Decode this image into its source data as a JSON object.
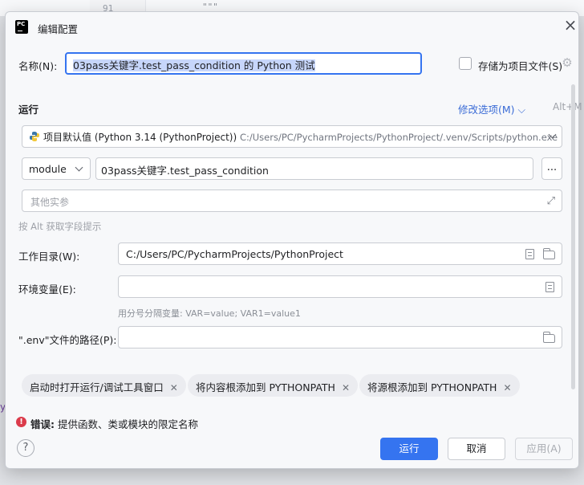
{
  "background": {
    "gutter_line": "91",
    "code_text": "\"\"\"",
    "left_glyph": "y"
  },
  "dialog": {
    "logo_text": "PC",
    "title": "编辑配置",
    "name_label": "名称(N):",
    "name_value": "03pass关键字.test_pass_condition 的 Python 测试",
    "store_as_file_label": "存储为项目文件(S)",
    "store_as_file_checked": false,
    "run_section": "运行",
    "modify_options": "修改选项(M)",
    "modify_shortcut": "Alt+M",
    "interpreter_label": "项目默认值 (Python 3.14 (PythonProject))",
    "interpreter_path": "C:/Users/PC/PycharmProjects/PythonProject/.venv/Scripts/python.exe",
    "target_type": "module",
    "target_value": "03pass关键字.test_pass_condition",
    "browse_button": "...",
    "additional_args_placeholder": "其他实参",
    "alt_hint": "按 Alt 获取字段提示",
    "workdir_label": "工作目录(W):",
    "workdir_value": "C:/Users/PC/PycharmProjects/PythonProject",
    "env_label": "环境变量(E):",
    "env_value": "",
    "env_hint": "用分号分隔变量: VAR=value; VAR1=value1",
    "dotenv_label": "\".env\"文件的路径(P):",
    "dotenv_value": "",
    "chips": [
      {
        "label": "启动时打开运行/调试工具窗口"
      },
      {
        "label": "将内容根添加到 PYTHONPATH"
      },
      {
        "label": "将源根添加到 PYTHONPATH"
      }
    ],
    "error_prefix": "错误:",
    "error_message": "提供函数、类或模块的限定名称",
    "help_button": "?",
    "run_button": "运行",
    "cancel_button": "取消",
    "apply_button": "应用(A)"
  },
  "colors": {
    "accent": "#3574f0",
    "error": "#db3b4b",
    "link": "#3a6bd6"
  }
}
